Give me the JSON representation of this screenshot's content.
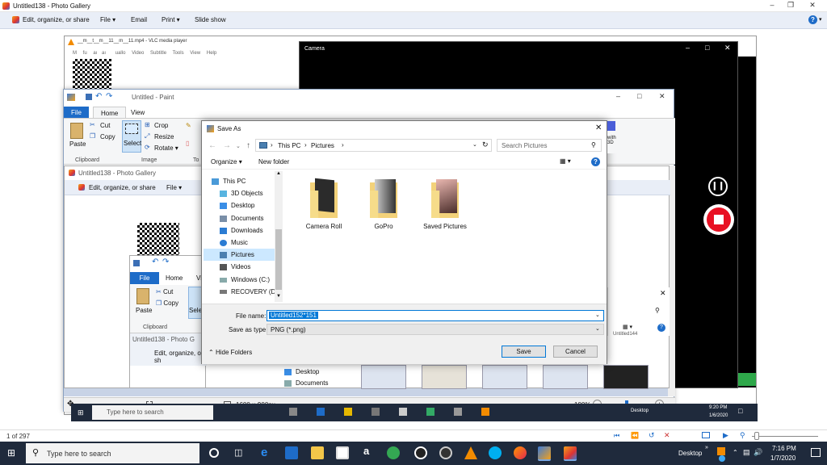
{
  "outer_gallery": {
    "title": "Untitled138 - Photo Gallery",
    "menu": [
      "Edit, organize, or share",
      "File",
      "Email",
      "Print",
      "Slide show"
    ],
    "status_count": "1 of 297"
  },
  "vlc": {
    "title": "__m__t__m__11__m__11.mp4 - VLC media player",
    "menu": [
      "M",
      "fu",
      "aı",
      "aı",
      "uallo",
      "Video",
      "Subtitle",
      "Tools",
      "View",
      "Help"
    ]
  },
  "camera": {
    "title": "Camera"
  },
  "paint": {
    "title": "Untitled - Paint",
    "tabs": [
      "File",
      "Home",
      "View"
    ],
    "tools": {
      "paste": "Paste",
      "cut": "Cut",
      "copy": "Copy",
      "select": "Select",
      "crop": "Crop",
      "resize": "Resize",
      "rotate": "Rotate"
    },
    "groups": [
      "Clipboard",
      "Image",
      "To"
    ],
    "size": "1600 × 900px",
    "zoom": "100%"
  },
  "inner_gallery": {
    "title": "Untitled138 - Photo Gallery",
    "menu": [
      "Edit, organize, or share",
      "File"
    ],
    "nav_items": [
      "Desktop",
      "Documents"
    ],
    "file_label": "Untitled144"
  },
  "inner_paint": {
    "tabs": [
      "File",
      "Home",
      "Vi"
    ],
    "tools": {
      "paste": "Paste",
      "cut": "Cut",
      "copy": "Copy",
      "select": "Selec"
    },
    "group": "Clipboard"
  },
  "inner_gallery2": {
    "title": "Untitled138 - Photo G",
    "menu": "Edit, organize, or sh"
  },
  "inner_taskbar": {
    "search": "Type here to search",
    "desktop": "Desktop",
    "time": "9:20 PM",
    "date": "1/6/2020"
  },
  "dialog": {
    "title": "Save As",
    "breadcrumb": [
      "This PC",
      "Pictures"
    ],
    "search_placeholder": "Search Pictures",
    "organize": "Organize",
    "new_folder": "New folder",
    "nav_items": [
      "This PC",
      "3D Objects",
      "Desktop",
      "Documents",
      "Downloads",
      "Music",
      "Pictures",
      "Videos",
      "Windows (C:)",
      "RECOVERY (D:)"
    ],
    "folders": [
      "Camera Roll",
      "GoPro",
      "Saved Pictures"
    ],
    "file_name_label": "File name:",
    "file_name_value": "Untitled152*151",
    "save_type_label": "Save as type:",
    "save_type_value": "PNG (*.png)",
    "hide_folders": "Hide Folders",
    "save": "Save",
    "cancel": "Cancel"
  },
  "taskbar": {
    "search": "Type here to search",
    "desktop": "Desktop",
    "time": "7:16 PM",
    "date": "1/7/2020"
  },
  "colors": {
    "accent": "#0078d7",
    "file_tab": "#1e6cc8",
    "record": "#e81123",
    "taskbar": "#1f2a3c"
  }
}
